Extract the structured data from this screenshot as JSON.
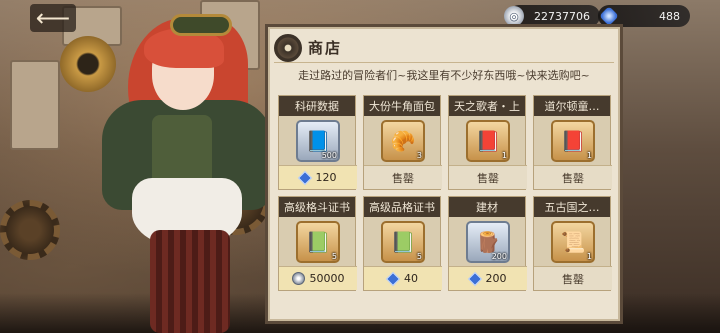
{
  "currencies": {
    "coin": {
      "value": "22737706",
      "icon": "silver-coin-icon"
    },
    "gem": {
      "value": "488",
      "icon": "blue-gem-icon"
    }
  },
  "nav": {
    "back_glyph": "⟵"
  },
  "shop": {
    "title": "商店",
    "dialog": "走过路过的冒险者们~我这里有不少好东西哦~快来选购吧~",
    "items": [
      {
        "name": "科研数据",
        "qty": "500",
        "icon": "book-icon",
        "frame": "blue",
        "price": "120",
        "currency": "gem",
        "sold": false,
        "sold_label": ""
      },
      {
        "name": "大份牛角面包",
        "qty": "3",
        "icon": "croissant-icon",
        "frame": "gold",
        "price": "",
        "currency": "",
        "sold": true,
        "sold_label": "售罄"
      },
      {
        "name": "天之歌者・上",
        "qty": "1",
        "icon": "tome-icon",
        "frame": "gold",
        "price": "",
        "currency": "",
        "sold": true,
        "sold_label": "售罄"
      },
      {
        "name": "道尔顿童…",
        "qty": "1",
        "icon": "tome-icon",
        "frame": "gold",
        "price": "",
        "currency": "",
        "sold": true,
        "sold_label": "售罄"
      },
      {
        "name": "高级格斗证书",
        "qty": "5",
        "icon": "certificate-icon",
        "frame": "gold",
        "price": "50000",
        "currency": "coin",
        "sold": false,
        "sold_label": ""
      },
      {
        "name": "高级品格证书",
        "qty": "5",
        "icon": "certificate-icon",
        "frame": "gold",
        "price": "40",
        "currency": "gem",
        "sold": false,
        "sold_label": ""
      },
      {
        "name": "建材",
        "qty": "200",
        "icon": "lumber-icon",
        "frame": "blue",
        "price": "200",
        "currency": "gem",
        "sold": false,
        "sold_label": ""
      },
      {
        "name": "五古国之…",
        "qty": "1",
        "icon": "scroll-icon",
        "frame": "gold",
        "price": "",
        "currency": "",
        "sold": true,
        "sold_label": "售罄"
      }
    ]
  }
}
